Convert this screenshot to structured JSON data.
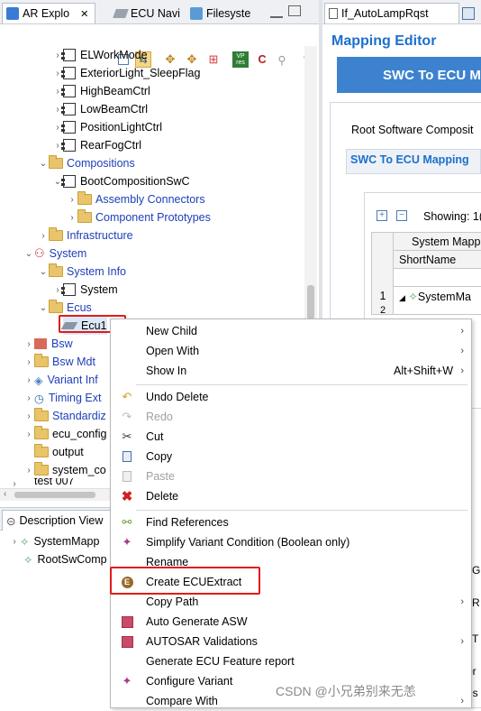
{
  "left_tabs": [
    {
      "label": "AR Explo",
      "close": "✕"
    },
    {
      "label": "ECU Navi"
    },
    {
      "label": "Filesyste"
    }
  ],
  "right_tabs": [
    {
      "label": "If_AutoLampRqst"
    }
  ],
  "tree": [
    {
      "label": "ELWorkMode"
    },
    {
      "label": "ExteriorLight_SleepFlag"
    },
    {
      "label": "HighBeamCtrl"
    },
    {
      "label": "LowBeamCtrl"
    },
    {
      "label": "PositionLightCtrl"
    },
    {
      "label": "RearFogCtrl"
    },
    {
      "label": "Compositions"
    },
    {
      "label": "BootCompositionSwC"
    },
    {
      "label": "Assembly Connectors"
    },
    {
      "label": "Component Prototypes"
    },
    {
      "label": "Infrastructure"
    },
    {
      "label": "System"
    },
    {
      "label": "System Info"
    },
    {
      "label": "System"
    },
    {
      "label": "Ecus"
    },
    {
      "label": "Ecu1"
    },
    {
      "label": "Bsw"
    },
    {
      "label": "Bsw Mdt"
    },
    {
      "label": "Variant Inf"
    },
    {
      "label": "Timing Ext"
    },
    {
      "label": "Standardiz"
    },
    {
      "label": "ecu_config"
    },
    {
      "label": "output"
    },
    {
      "label": "system_co"
    },
    {
      "label": "test 007"
    }
  ],
  "description_view": {
    "tab_label": "Description View",
    "items": [
      "SystemMapp",
      "RootSwComp"
    ]
  },
  "editor": {
    "title": "Mapping Editor",
    "banner": "SWC To ECU M",
    "section_title": "Root Software Composit",
    "tab_label": "SWC To ECU Mapping",
    "showing_label": "Showing: 1(",
    "table_header_top": "System Mapp",
    "table_header_col": "ShortName",
    "row1_num": "1",
    "row1_name": "SystemMa",
    "row2_num": "2",
    "right_edge_letters": [
      "G",
      "R",
      "T",
      "or",
      "es"
    ]
  },
  "context_menu": [
    {
      "label": "New Child",
      "icon": "none",
      "submenu": true
    },
    {
      "label": "Open With",
      "icon": "none",
      "submenu": true
    },
    {
      "label": "Show In",
      "icon": "none",
      "shortcut": "Alt+Shift+W",
      "submenu": true
    },
    {
      "sep": true
    },
    {
      "label": "Undo Delete",
      "icon": "undo-icon"
    },
    {
      "label": "Redo",
      "icon": "redo-icon",
      "disabled": true
    },
    {
      "label": "Cut",
      "icon": "scissors-icon"
    },
    {
      "label": "Copy",
      "icon": "copy-icon"
    },
    {
      "label": "Paste",
      "icon": "paste-icon",
      "disabled": true
    },
    {
      "label": "Delete",
      "icon": "delete-icon"
    },
    {
      "sep": true
    },
    {
      "label": "Find References",
      "icon": "find-references-icon"
    },
    {
      "label": "Simplify Variant Condition (Boolean only)",
      "icon": "variant-icon"
    },
    {
      "label": "Rename",
      "icon": "none"
    },
    {
      "label": "Create ECUExtract",
      "icon": "ecu-extract-icon"
    },
    {
      "label": "Copy Path",
      "icon": "none",
      "submenu": true
    },
    {
      "label": "Auto Generate ASW",
      "icon": "generate-icon"
    },
    {
      "label": "AUTOSAR Validations",
      "icon": "validation-icon",
      "submenu": true
    },
    {
      "label": "Generate ECU Feature report",
      "icon": "none"
    },
    {
      "label": "Configure Variant",
      "icon": "variant-icon"
    },
    {
      "label": "Compare With",
      "icon": "none",
      "submenu": true
    }
  ],
  "watermark": "CSDN @小兄弟别来无恙",
  "colors": {
    "accent_blue": "#1d6fcc",
    "highlight_red": "#e21b1b",
    "folder_yellow": "#e9c46a"
  }
}
